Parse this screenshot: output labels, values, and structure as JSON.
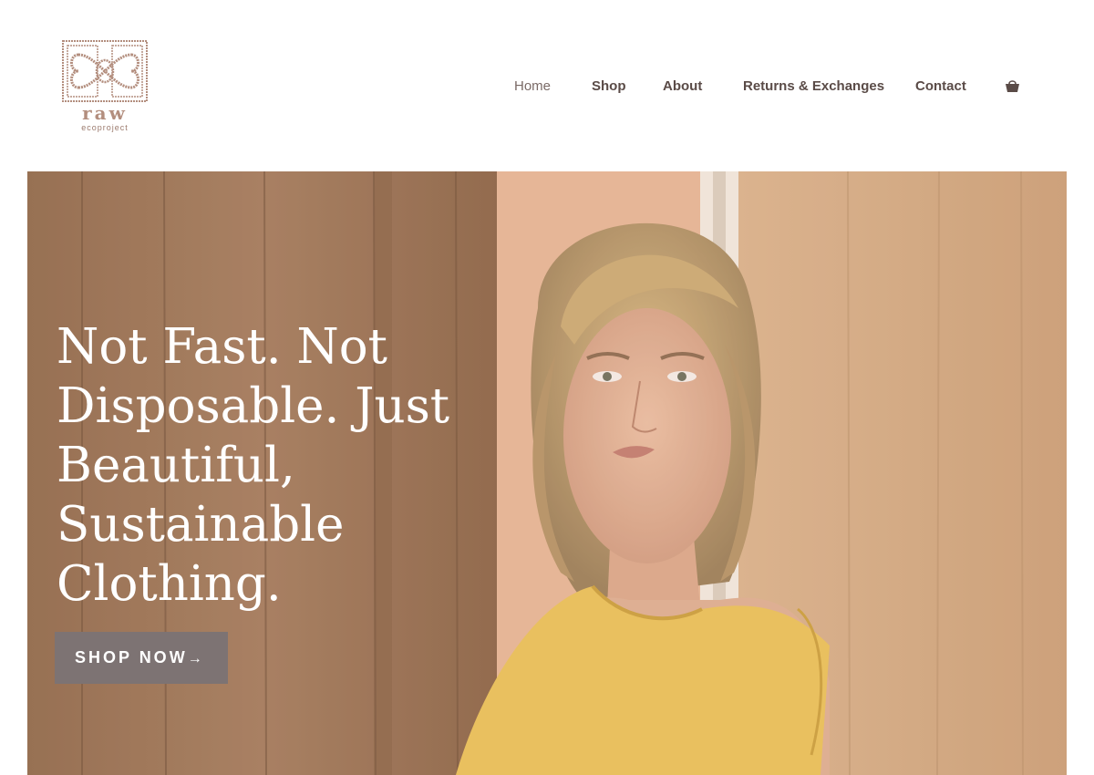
{
  "brand": {
    "wordmark": "raw",
    "tagline": "ecoproject",
    "logo_icon": "celtic-knot-logo",
    "color": "#b38e7e"
  },
  "nav": {
    "items": [
      {
        "label": "Home",
        "active": true
      },
      {
        "label": "Shop"
      },
      {
        "label": "About"
      },
      {
        "label": "Returns & Exchanges"
      },
      {
        "label": "Contact"
      }
    ],
    "cart_icon": "shopping-bag-icon",
    "text_color": "#5a4b47"
  },
  "hero": {
    "headline": "Not Fast. Not Disposable. Just Beautiful, Sustainable Clothing.",
    "cta_label": "SHOP NOW",
    "cta_arrow": "→",
    "cta_color": "#7d7373",
    "image_description_icon": "hero-photo"
  }
}
